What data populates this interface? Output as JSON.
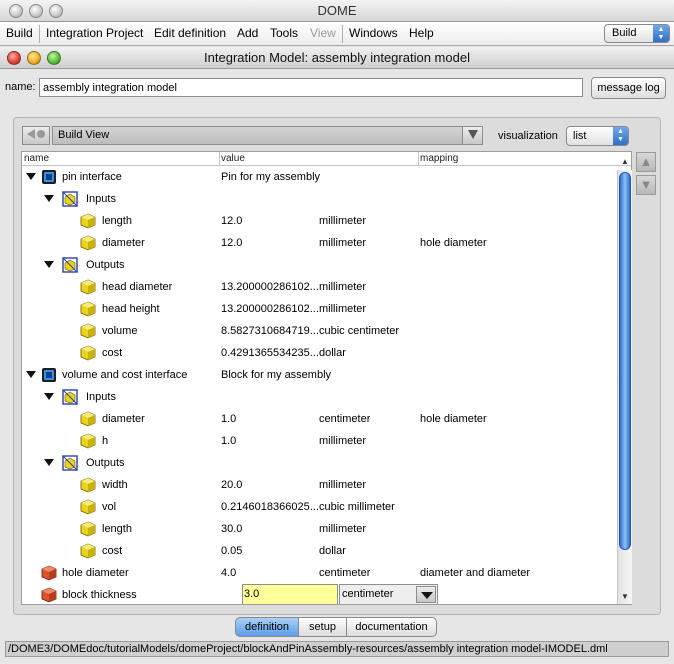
{
  "app": {
    "title": "DOME"
  },
  "menubar": {
    "items": [
      "Build",
      "Integration Project",
      "Edit definition",
      "Add",
      "Tools",
      "View",
      "Windows",
      "Help"
    ],
    "build_select": "Build"
  },
  "window": {
    "title": "Integration Model: assembly integration model"
  },
  "name_field": {
    "label": "name:",
    "value": "assembly integration model"
  },
  "message_log_button": "message log",
  "view_select": {
    "value": "Build View"
  },
  "visualization": {
    "label": "visualization",
    "value": "list"
  },
  "table": {
    "headers": {
      "name": "name",
      "value": "value",
      "mapping": "mapping"
    },
    "rows": [
      {
        "level": 0,
        "expand": true,
        "icon": "interface",
        "name": "pin interface",
        "value": "Pin  for my assembly",
        "unit": "",
        "mapping": ""
      },
      {
        "level": 1,
        "expand": true,
        "icon": "filter",
        "name": "Inputs",
        "value": "",
        "unit": "",
        "mapping": ""
      },
      {
        "level": 2,
        "expand": false,
        "icon": "parameter",
        "name": "length",
        "value": "12.0",
        "unit": "millimeter",
        "mapping": ""
      },
      {
        "level": 2,
        "expand": false,
        "icon": "parameter",
        "name": "diameter",
        "value": "12.0",
        "unit": "millimeter",
        "mapping": "hole diameter"
      },
      {
        "level": 1,
        "expand": true,
        "icon": "filter",
        "name": "Outputs",
        "value": "",
        "unit": "",
        "mapping": ""
      },
      {
        "level": 2,
        "expand": false,
        "icon": "parameter",
        "name": "head diameter",
        "value": "13.200000286102...",
        "unit": "millimeter",
        "mapping": ""
      },
      {
        "level": 2,
        "expand": false,
        "icon": "parameter",
        "name": "head height",
        "value": "13.200000286102...",
        "unit": "millimeter",
        "mapping": ""
      },
      {
        "level": 2,
        "expand": false,
        "icon": "parameter",
        "name": "volume",
        "value": "8.5827310684719...",
        "unit": "cubic centimeter",
        "mapping": ""
      },
      {
        "level": 2,
        "expand": false,
        "icon": "parameter",
        "name": "cost",
        "value": "0.4291365534235...",
        "unit": "dollar",
        "mapping": ""
      },
      {
        "level": 0,
        "expand": true,
        "icon": "interface",
        "name": "volume and cost interface",
        "value": "Block for my assembly",
        "unit": "",
        "mapping": ""
      },
      {
        "level": 1,
        "expand": true,
        "icon": "filter",
        "name": "Inputs",
        "value": "",
        "unit": "",
        "mapping": ""
      },
      {
        "level": 2,
        "expand": false,
        "icon": "parameter",
        "name": "diameter",
        "value": "1.0",
        "unit": "centimeter",
        "mapping": "hole diameter"
      },
      {
        "level": 2,
        "expand": false,
        "icon": "parameter",
        "name": "h",
        "value": "1.0",
        "unit": "millimeter",
        "mapping": ""
      },
      {
        "level": 1,
        "expand": true,
        "icon": "filter",
        "name": "Outputs",
        "value": "",
        "unit": "",
        "mapping": ""
      },
      {
        "level": 2,
        "expand": false,
        "icon": "parameter",
        "name": "width",
        "value": "20.0",
        "unit": "millimeter",
        "mapping": ""
      },
      {
        "level": 2,
        "expand": false,
        "icon": "parameter",
        "name": "vol",
        "value": "0.2146018366025...",
        "unit": "cubic millimeter",
        "mapping": ""
      },
      {
        "level": 2,
        "expand": false,
        "icon": "parameter",
        "name": "length",
        "value": "30.0",
        "unit": "millimeter",
        "mapping": ""
      },
      {
        "level": 2,
        "expand": false,
        "icon": "parameter",
        "name": "cost",
        "value": "0.05",
        "unit": "dollar",
        "mapping": ""
      },
      {
        "level": 0,
        "expand": false,
        "icon": "real",
        "name": "hole diameter",
        "value": "4.0",
        "unit": "centimeter",
        "mapping": "diameter and diameter"
      },
      {
        "level": 0,
        "expand": false,
        "icon": "real",
        "name": "block thickness",
        "value": "3.0",
        "unit": "centimeter",
        "mapping": "",
        "editing": true
      }
    ]
  },
  "tabs": [
    "definition",
    "setup",
    "documentation"
  ],
  "active_tab": "definition",
  "status_path": "/DOME3/DOMEdoc/tutorialModels/domeProject/blockAndPinAssembly-resources/assembly integration model-IMODEL.dml",
  "colors": {
    "edit_highlight": "#ffff99",
    "tab_active": "#5d9ee8",
    "scroll_thumb": "#2c6dd0",
    "parameter_cube": "#e8d41a",
    "real_cube": "#d9532b"
  }
}
